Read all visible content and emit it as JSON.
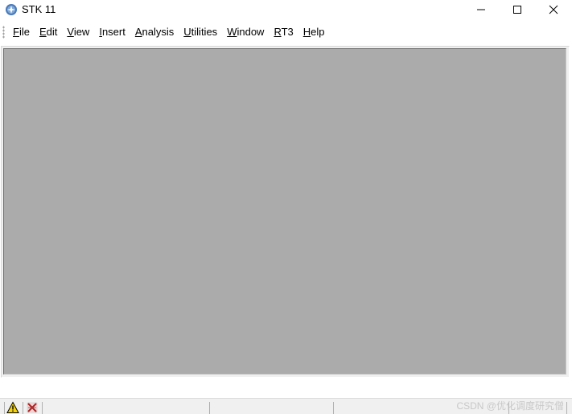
{
  "window": {
    "title": "STK 11"
  },
  "menubar": {
    "items": [
      {
        "key": "F",
        "rest": "ile"
      },
      {
        "key": "E",
        "rest": "dit"
      },
      {
        "key": "V",
        "rest": "iew"
      },
      {
        "key": "I",
        "rest": "nsert"
      },
      {
        "key": "A",
        "rest": "nalysis"
      },
      {
        "key": "U",
        "rest": "tilities"
      },
      {
        "key": "W",
        "rest": "indow"
      },
      {
        "key": "R",
        "rest": "T3"
      },
      {
        "key": "H",
        "rest": "elp"
      }
    ]
  },
  "statusbar": {
    "icons": [
      "warning-icon",
      "cancel-x-icon"
    ],
    "watermark": "CSDN @优化调度研究僧"
  },
  "colors": {
    "client_area": "#ababab",
    "status_bar": "#f0f0f0",
    "title_bar": "#ffffff"
  }
}
